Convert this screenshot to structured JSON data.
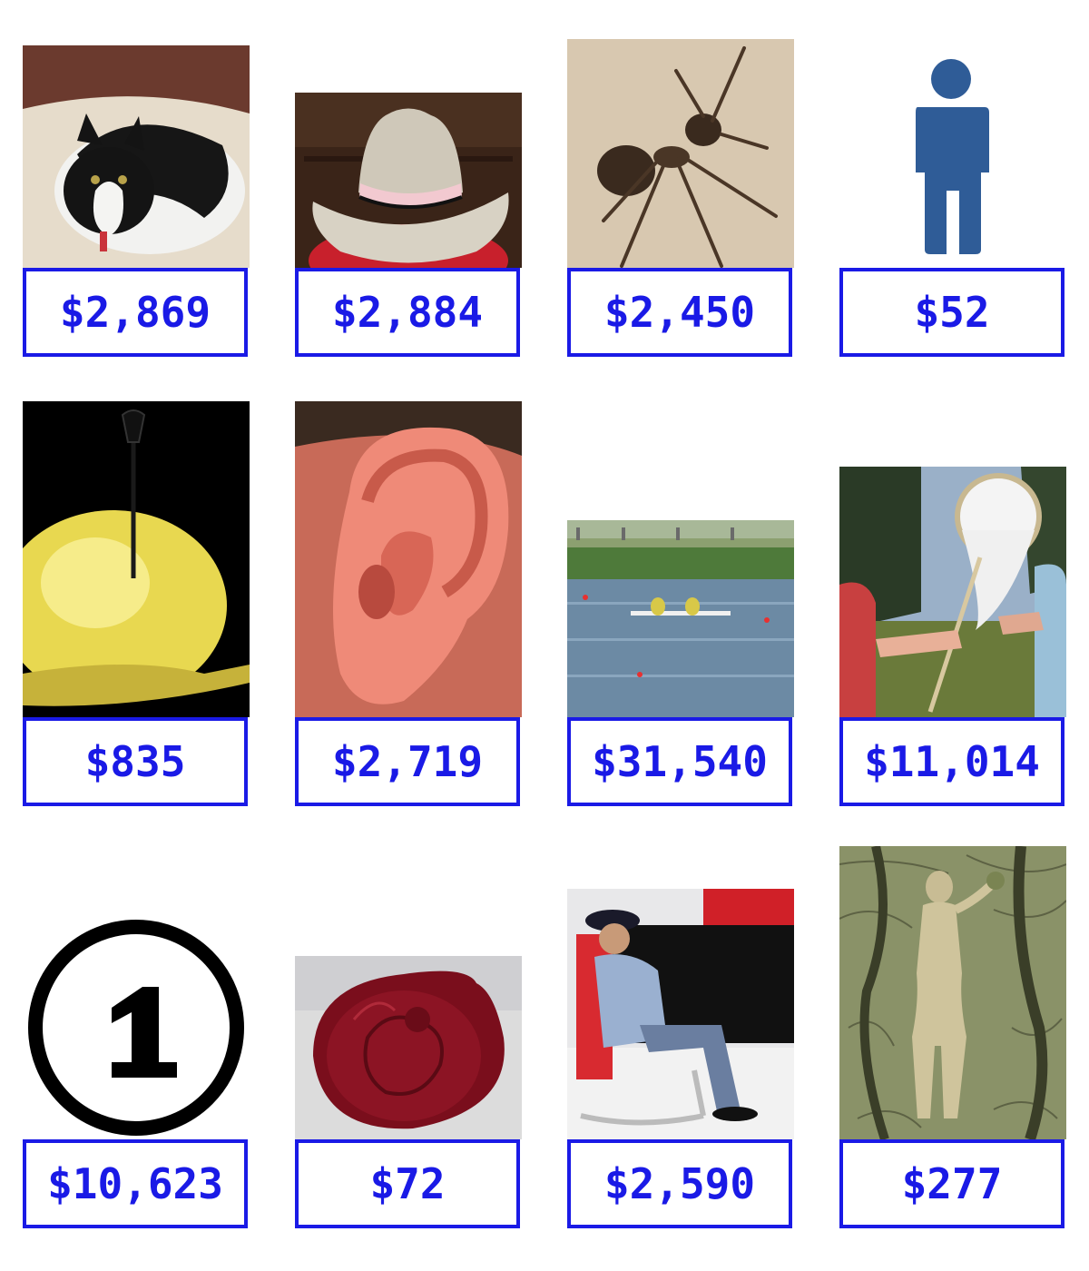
{
  "accent_color": "#1a1ae6",
  "items": [
    {
      "icon": "cat-photo",
      "price": "$2,869"
    },
    {
      "icon": "cowboy-hat-photo",
      "price": "$2,884"
    },
    {
      "icon": "ant-photo",
      "price": "$2,450"
    },
    {
      "icon": "person-pictogram-icon",
      "price": "$52"
    },
    {
      "icon": "balloon-dart-photo",
      "price": "$835"
    },
    {
      "icon": "ear-photo",
      "price": "$2,719"
    },
    {
      "icon": "rowing-lake-photo",
      "price": "$31,540"
    },
    {
      "icon": "butterfly-net-photo",
      "price": "$11,014"
    },
    {
      "icon": "circled-number-one-icon",
      "price": "$10,623"
    },
    {
      "icon": "wax-seal-photo",
      "price": "$72"
    },
    {
      "icon": "sleeping-guard-photo",
      "price": "$2,590"
    },
    {
      "icon": "engraving-eve-photo",
      "price": "$277"
    }
  ]
}
